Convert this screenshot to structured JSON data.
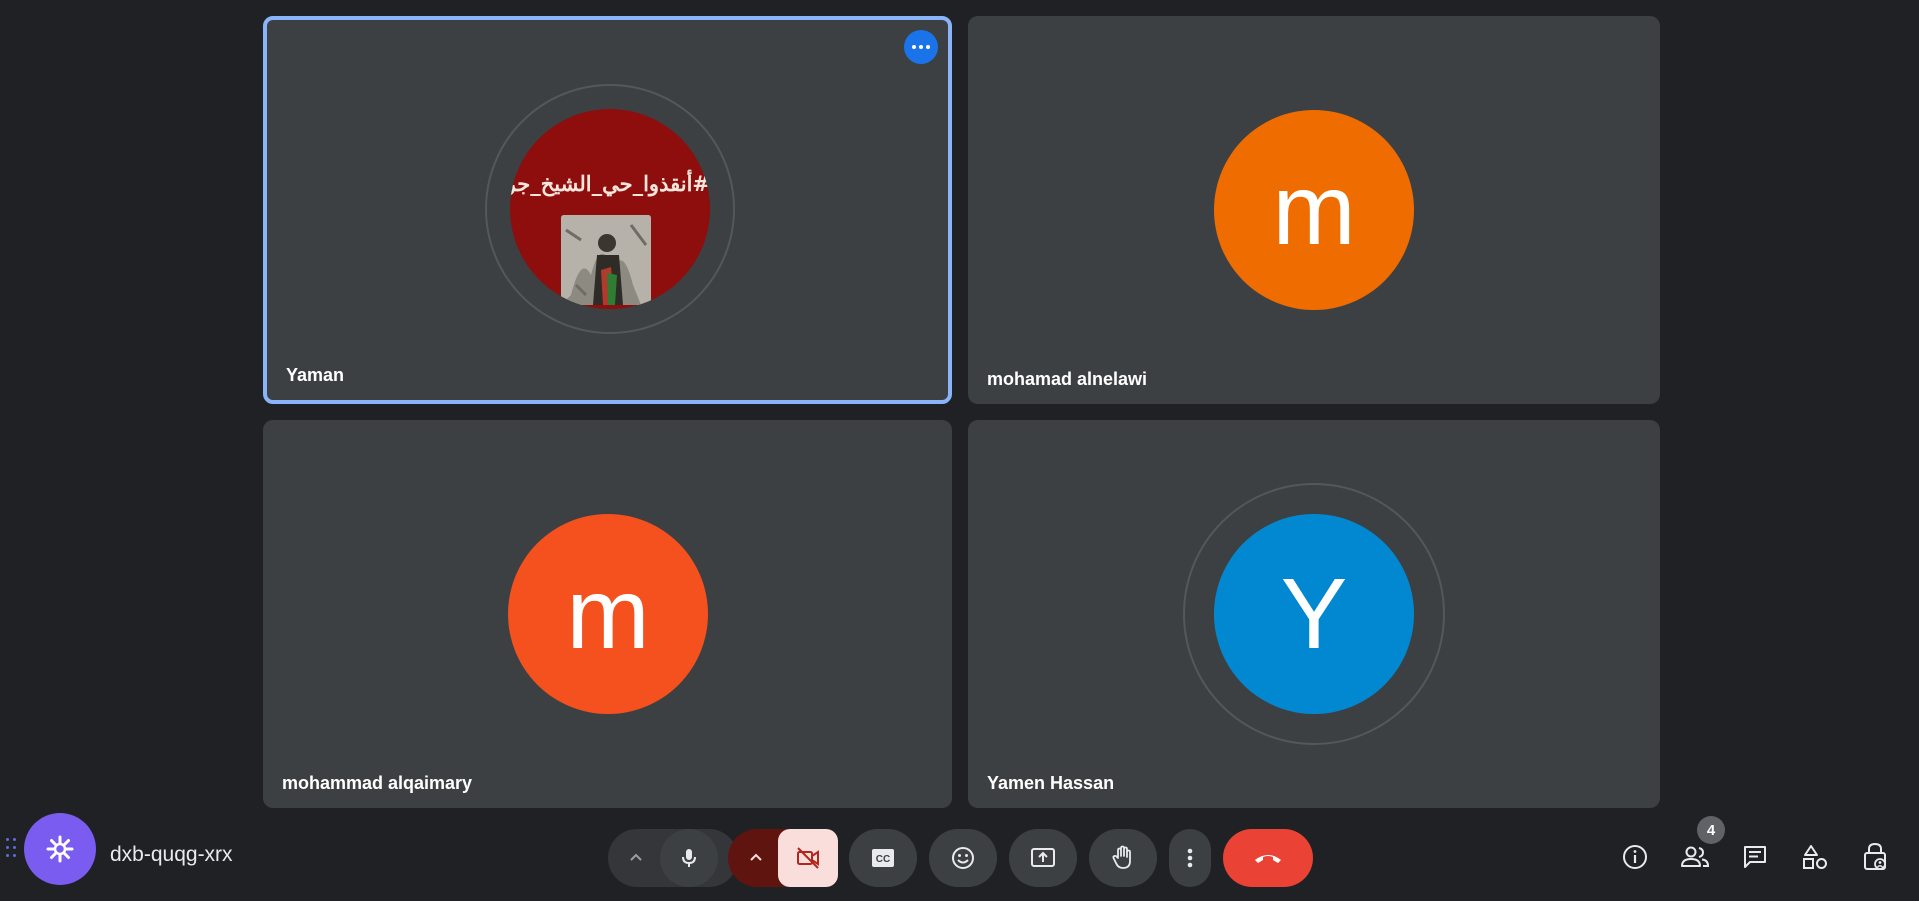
{
  "meeting": {
    "code": "dxb-quqg-xrx",
    "participant_count": "4"
  },
  "participants": [
    {
      "name": "Yaman",
      "avatar_type": "image",
      "avatar_text": "#أنقذوا_حي_الشيخ_جراح",
      "avatar_bg": "#8e0d0d",
      "active_speaker": true
    },
    {
      "name": "mohamad alnelawi",
      "avatar_type": "letter",
      "avatar_letter": "m",
      "avatar_bg": "#ef6c00"
    },
    {
      "name": "mohammad alqaimary",
      "avatar_type": "letter",
      "avatar_letter": "m",
      "avatar_bg": "#f4511e"
    },
    {
      "name": "Yamen Hassan",
      "avatar_type": "letter",
      "avatar_letter": "Y",
      "avatar_bg": "#0288d1"
    }
  ],
  "controls": {
    "audio_options_icon": "chevron-up-icon",
    "mic_icon": "mic-icon",
    "video_options_icon": "chevron-up-icon",
    "camera_icon": "camera-off-icon",
    "captions_icon": "closed-captions-icon",
    "emoji_icon": "emoji-icon",
    "present_icon": "present-screen-icon",
    "raise_hand_icon": "hand-icon",
    "more_icon": "more-vert-icon",
    "leave_icon": "end-call-icon"
  },
  "side_panel": {
    "info_icon": "info-icon",
    "people_icon": "people-icon",
    "chat_icon": "chat-icon",
    "activities_icon": "activities-icon",
    "host_controls_icon": "lock-person-icon"
  },
  "colors": {
    "background": "#202124",
    "tile": "#3c4043",
    "active_border": "#8ab4f8",
    "leave_red": "#ea4335",
    "camera_off_bg": "#f9dedc",
    "camera_off_group": "#601410",
    "accent_blue": "#1a73e8",
    "app_badge": "#7b5cf0"
  }
}
